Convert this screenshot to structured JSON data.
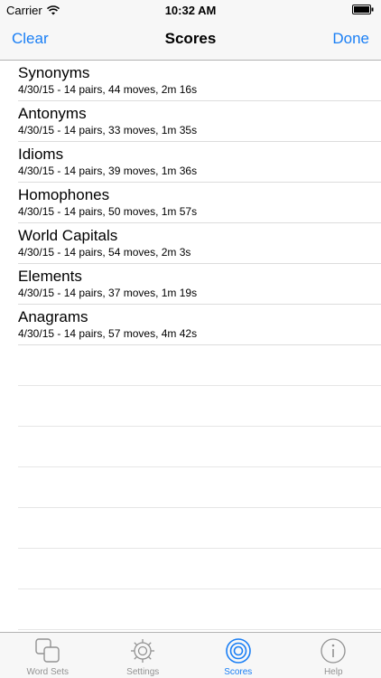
{
  "status_bar": {
    "carrier": "Carrier",
    "time": "10:32 AM",
    "wifi_icon": "wifi-icon",
    "battery_icon": "battery-icon"
  },
  "nav": {
    "left_button": "Clear",
    "title": "Scores",
    "right_button": "Done"
  },
  "scores": [
    {
      "title": "Synonyms",
      "detail": "4/30/15 - 14 pairs, 44 moves, 2m 16s"
    },
    {
      "title": "Antonyms",
      "detail": "4/30/15 - 14 pairs, 33 moves, 1m 35s"
    },
    {
      "title": "Idioms",
      "detail": "4/30/15 - 14 pairs, 39 moves, 1m 36s"
    },
    {
      "title": "Homophones",
      "detail": "4/30/15 - 14 pairs, 50 moves, 1m 57s"
    },
    {
      "title": "World Capitals",
      "detail": "4/30/15 - 14 pairs, 54 moves, 2m 3s"
    },
    {
      "title": "Elements",
      "detail": "4/30/15 - 14 pairs, 37 moves, 1m 19s"
    },
    {
      "title": "Anagrams",
      "detail": "4/30/15 - 14 pairs, 57 moves, 4m 42s"
    }
  ],
  "tabs": [
    {
      "label": "Word Sets",
      "icon": "word-sets-icon",
      "active": false
    },
    {
      "label": "Settings",
      "icon": "gear-icon",
      "active": false
    },
    {
      "label": "Scores",
      "icon": "target-icon",
      "active": true
    },
    {
      "label": "Help",
      "icon": "info-icon",
      "active": false
    }
  ],
  "colors": {
    "accent": "#1a7ff5",
    "inactive_tab": "#929292",
    "bar_background": "#f7f7f7"
  }
}
